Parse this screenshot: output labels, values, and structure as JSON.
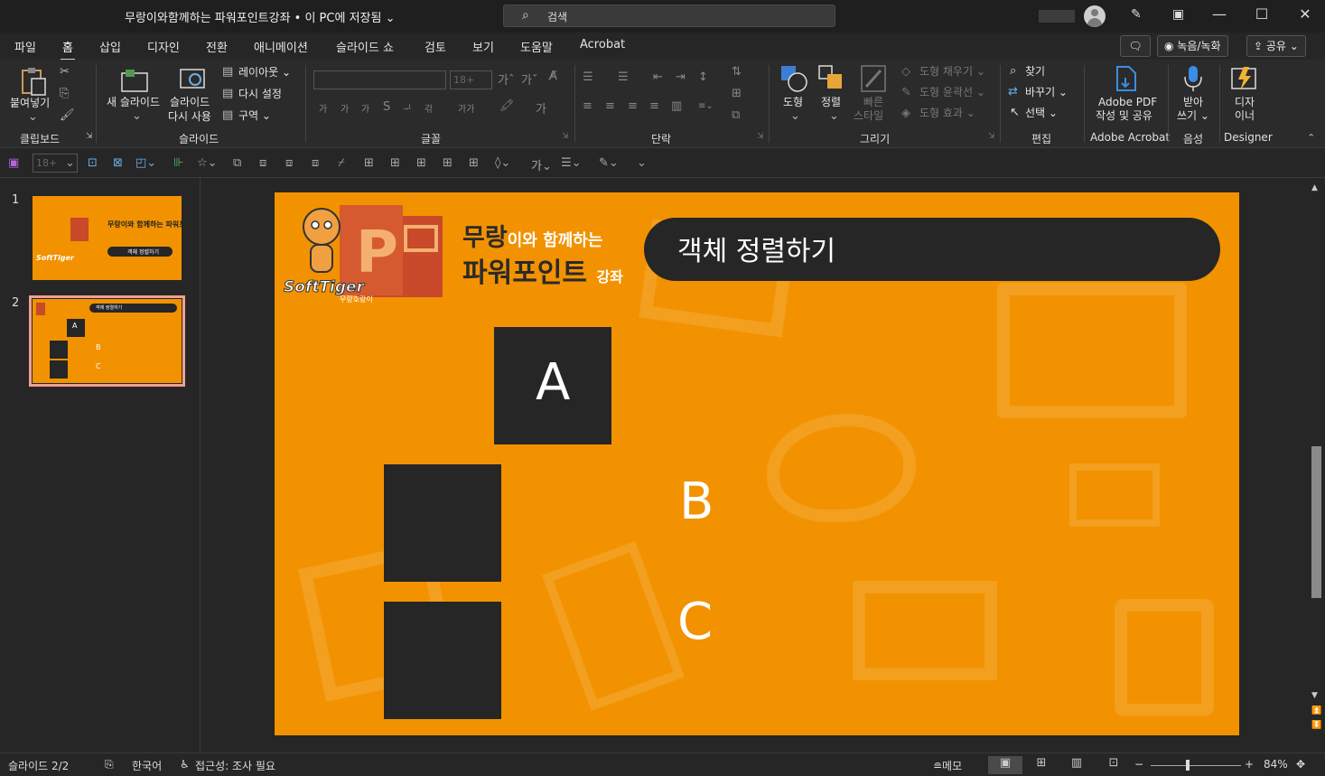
{
  "titlebar": {
    "doc_title": "무랑이와함께하는 파워포인트강좌 • 이 PC에 저장됨 ⌄",
    "search_placeholder": "검색",
    "search_icon": "search-icon",
    "pen_icon": "pen-icon",
    "ribbon_toggle_icon": "ribbon-display-icon",
    "minimize": "—",
    "restore": "☐",
    "close": "✕"
  },
  "menu": {
    "tabs": [
      "파일",
      "홈",
      "삽입",
      "디자인",
      "전환",
      "애니메이션",
      "슬라이드 쇼",
      "검토",
      "보기",
      "도움말",
      "Acrobat"
    ],
    "active_tab": "홈",
    "comments_icon": "comments-icon",
    "record_label": "◉ 녹음/녹화",
    "share_label": "⇪ 공유 ⌄"
  },
  "ribbon": {
    "clipboard": {
      "paste": "붙여넣기",
      "group": "클립보드"
    },
    "slides": {
      "new_slide": "새 슬라이드",
      "reuse_line1": "슬라이드",
      "reuse_line2": "다시 사용",
      "layout": "레이아웃 ⌄",
      "reset": "다시 설정",
      "section": "구역 ⌄",
      "group": "슬라이드"
    },
    "font": {
      "size": "18+",
      "group": "글꼴"
    },
    "paragraph": {
      "group": "단락"
    },
    "drawing": {
      "shapes": "도형",
      "arrange": "정렬",
      "quick_styles_line1": "빠른",
      "quick_styles_line2": "스타일",
      "fill": "도형 채우기 ⌄",
      "outline": "도형 윤곽선 ⌄",
      "effects": "도형 효과 ⌄",
      "group": "그리기"
    },
    "editing": {
      "find": "찾기",
      "replace": "바꾸기 ⌄",
      "select": "선택 ⌄",
      "group": "편집"
    },
    "acrobat": {
      "line1": "Adobe PDF",
      "line2": "작성 및 공유",
      "group": "Adobe Acrobat"
    },
    "voice": {
      "line1": "받아",
      "line2": "쓰기 ⌄",
      "group": "음성"
    },
    "designer": {
      "line1": "디자",
      "line2": "이너",
      "group": "Designer"
    }
  },
  "qat": {
    "size": "18+"
  },
  "thumbnails": [
    {
      "number": "1",
      "title": "무랑이와 함께하는 파워포인트 강좌",
      "pill": "객체 정렬하기",
      "selected": false
    },
    {
      "number": "2",
      "pill": "객체 정렬하기",
      "labels": [
        "A",
        "B",
        "C"
      ],
      "selected": true
    }
  ],
  "slide": {
    "brand_line1_dark": "무랑",
    "brand_line1_white": "이와 함께하는",
    "brand_line2_dark": "파워포인트",
    "brand_line2_white": "강좌",
    "logo_text": "SoftTiger",
    "logo_sub": "무랑호랑이",
    "title": "객체 정렬하기",
    "shape_a_label": "A",
    "label_b": "B",
    "label_c": "C",
    "accent_color": "#f29200",
    "shape_color": "#262626"
  },
  "status": {
    "slide_counter": "슬라이드 2/2",
    "language": "한국어",
    "accessibility": "접근성: 조사 필요",
    "notes": "≘메모",
    "zoom": "84%"
  }
}
